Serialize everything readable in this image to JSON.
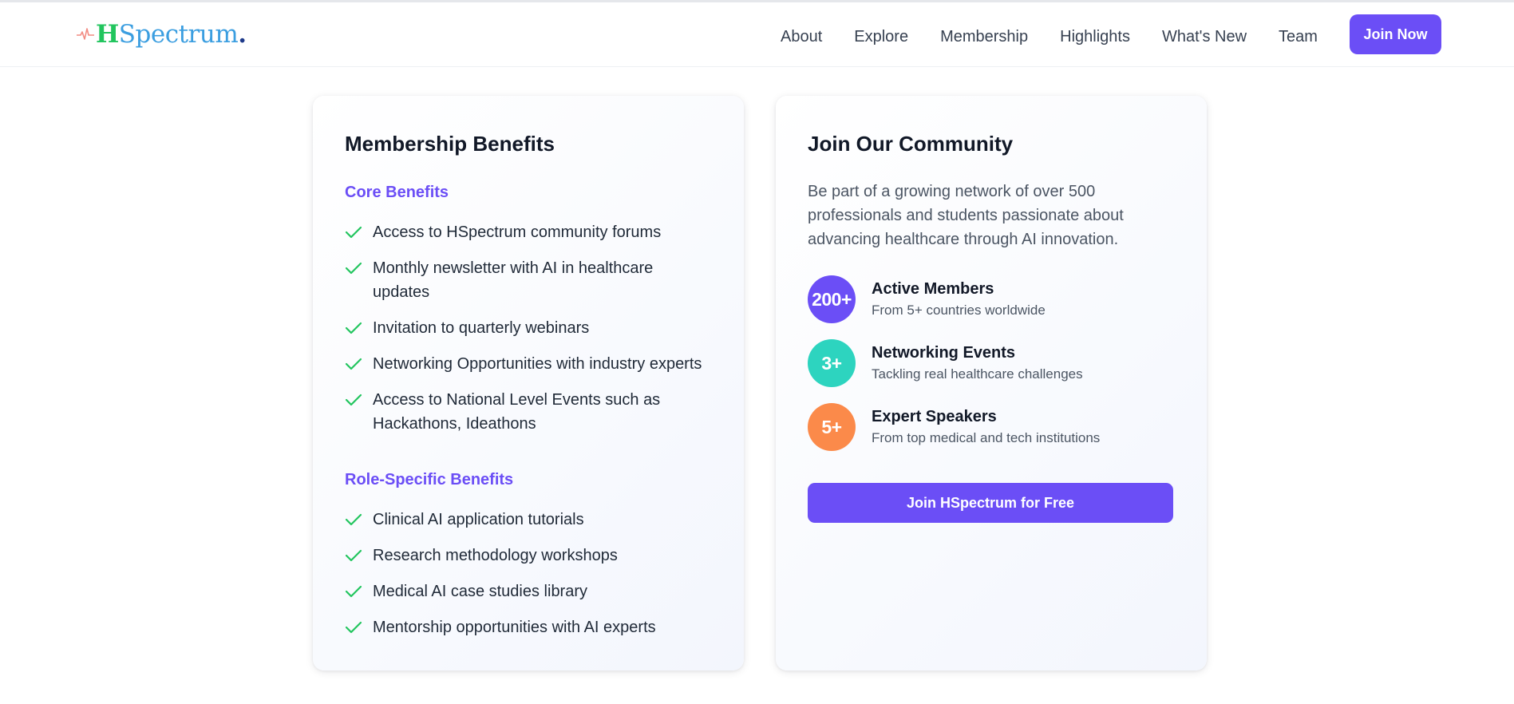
{
  "header": {
    "logo": {
      "text_h": "H",
      "text_rest": "Spectrum",
      "text_dot": ".",
      "icon": "heartbeat-pulse-icon"
    },
    "nav": [
      "About",
      "Explore",
      "Membership",
      "Highlights",
      "What's New",
      "Team"
    ],
    "join_label": "Join Now"
  },
  "benefits_card": {
    "title": "Membership Benefits",
    "core": {
      "title": "Core Benefits",
      "items": [
        "Access to HSpectrum community forums",
        "Monthly newsletter with AI in healthcare updates",
        "Invitation to quarterly webinars",
        "Networking Opportunities with industry experts",
        "Access to National Level Events such as Hackathons, Ideathons"
      ]
    },
    "role": {
      "title": "Role-Specific Benefits",
      "items": [
        "Clinical AI application tutorials",
        "Research methodology workshops",
        "Medical AI case studies library",
        "Mentorship opportunities with AI experts"
      ]
    }
  },
  "community_card": {
    "title": "Join Our Community",
    "intro": "Be part of a growing network of over 500 professionals and students passionate about advancing healthcare through AI innovation.",
    "stats": [
      {
        "value": "200+",
        "title": "Active Members",
        "subtitle": "From 5+ countries worldwide",
        "color": "#6b4ef6"
      },
      {
        "value": "3+",
        "title": "Networking Events",
        "subtitle": "Tackling real healthcare challenges",
        "color": "#2dd4bf"
      },
      {
        "value": "5+",
        "title": "Expert Speakers",
        "subtitle": "From top medical and tech institutions",
        "color": "#fb8a4a"
      }
    ],
    "cta_label": "Join HSpectrum for Free"
  },
  "colors": {
    "accent": "#6b4ef6",
    "check": "#22c55e"
  }
}
